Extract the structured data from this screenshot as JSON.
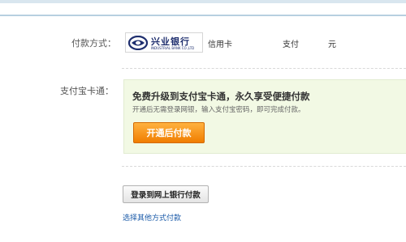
{
  "payment": {
    "label": "付款方式：",
    "bank_logo": {
      "name_cn": "兴业银行",
      "name_en": "INDUSTRIAL BANK CO.,LTD",
      "icon": "industrial-bank-logo"
    },
    "card_type": "信用卡",
    "pay_text": "支付",
    "currency_unit": "元"
  },
  "alipay_card": {
    "label": "支付宝卡通：",
    "title": "免费升级到支付宝卡通，永久享受便捷付款",
    "subtitle": "开通后无需登录网银，输入支付宝密码，即可完成付款。",
    "open_button": "开通后付款"
  },
  "actions": {
    "login_button": "登录到网上银行付款",
    "other_methods_link": "选择其他方式付款"
  },
  "colors": {
    "accent_orange": "#f07d00",
    "promo_bg": "#f2f9e4",
    "link_blue": "#1a5aa8",
    "bank_blue": "#1e2e6e"
  }
}
